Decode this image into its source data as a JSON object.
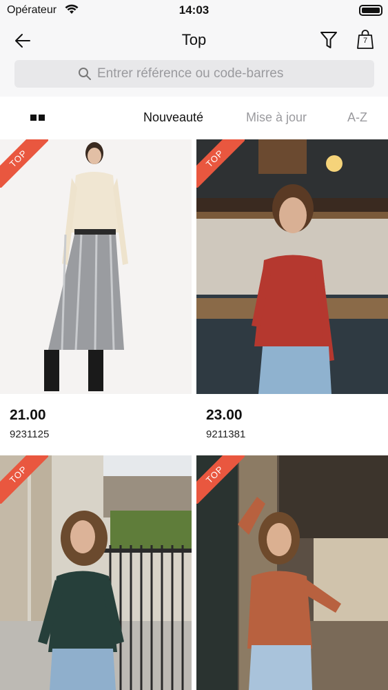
{
  "status_bar": {
    "carrier": "Opérateur",
    "time": "14:03"
  },
  "nav": {
    "title": "Top",
    "bag_count": "7"
  },
  "search": {
    "placeholder": "Entrer référence ou code-barres",
    "value": ""
  },
  "sort_tabs": [
    {
      "label": "Nouveauté",
      "active": true
    },
    {
      "label": "Mise à jour",
      "active": false
    },
    {
      "label": "A-Z",
      "active": false
    }
  ],
  "products": [
    {
      "badge": "TOP",
      "price": "21.00",
      "reference": "9231125"
    },
    {
      "badge": "TOP",
      "price": "23.00",
      "reference": "9211381"
    },
    {
      "badge": "TOP",
      "price": "",
      "reference": ""
    },
    {
      "badge": "TOP",
      "price": "",
      "reference": ""
    }
  ],
  "colors": {
    "badge": "#e9573f",
    "header_bg": "#f7f7f8",
    "search_bg": "#e8e8ea",
    "inactive_tab": "#9a9a9e"
  }
}
